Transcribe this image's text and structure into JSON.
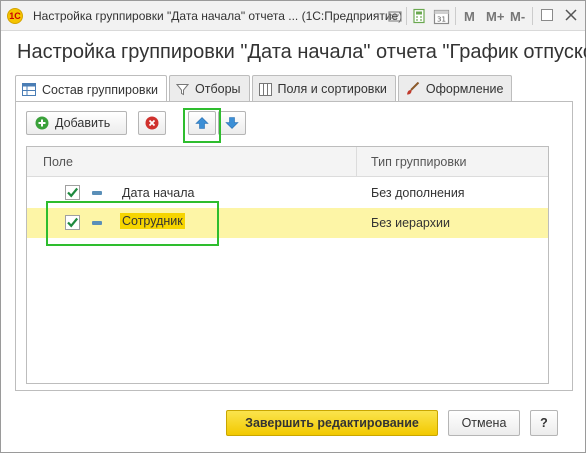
{
  "titlebar": {
    "title": "Настройка группировки \"Дата начала\" отчета ... (1С:Предприятие)",
    "icons": [
      "doc-icon",
      "calculator-icon",
      "calendar-icon",
      "memory-m-icon",
      "memory-mplus-icon",
      "memory-mminus-icon",
      "minimize-icon",
      "close-icon"
    ],
    "m_labels": [
      "M",
      "M+",
      "M-"
    ],
    "calendar_day": "31"
  },
  "heading": "Настройка группировки \"Дата начала\" отчета \"График отпуско...",
  "tabs": [
    {
      "label": "Состав группировки",
      "icon": "table-icon",
      "active": true
    },
    {
      "label": "Отборы",
      "icon": "filter-icon",
      "active": false
    },
    {
      "label": "Поля и сортировки",
      "icon": "columns-icon",
      "active": false
    },
    {
      "label": "Оформление",
      "icon": "brush-icon",
      "active": false
    }
  ],
  "toolbar": {
    "add_label": "Добавить",
    "add_icon": "plus-circle-icon",
    "delete_icon": "delete-x-icon",
    "up_icon": "arrow-up-icon",
    "down_icon": "arrow-down-icon"
  },
  "grid": {
    "columns": [
      "Поле",
      "Тип группировки"
    ],
    "rows": [
      {
        "checked": true,
        "field": "Дата начала",
        "type": "Без дополнения",
        "selected": false
      },
      {
        "checked": true,
        "field": "Сотрудник",
        "type": "Без иерархии",
        "selected": true
      }
    ]
  },
  "footer": {
    "finish_label": "Завершить редактирование",
    "cancel_label": "Отмена",
    "help_label": "?"
  },
  "colors": {
    "accent_yellow": "#f6d500",
    "selection_row": "#fdf5a6",
    "highlight_green": "#2ebd2e",
    "arrow_blue": "#3c8fd6"
  }
}
